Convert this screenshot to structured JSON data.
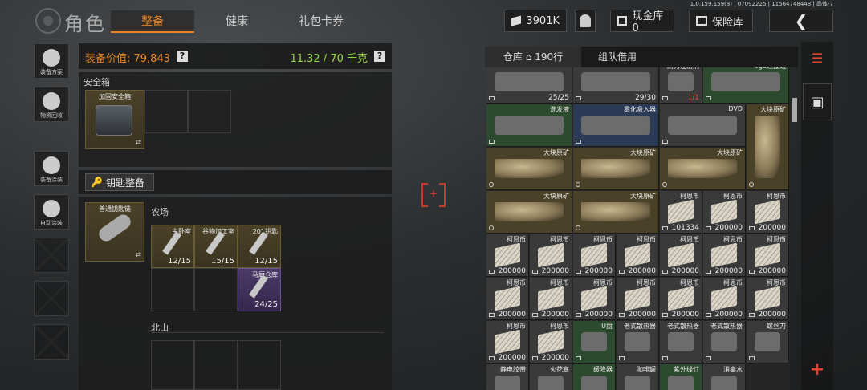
{
  "header": {
    "title": "角色",
    "tabs": [
      {
        "label": "整备",
        "active": true
      },
      {
        "label": "健康",
        "active": false
      },
      {
        "label": "礼包卡券",
        "active": false
      }
    ],
    "version": "1.0.159.159(8) | 07092225 | 11564748448 | 晶体-7",
    "money": "3901K",
    "cash_label": "现金库 0",
    "safe_label": "保险库",
    "back_icon": "chevron-left-icon"
  },
  "sidebar": [
    {
      "label": "装备方案",
      "icon": "gun-icon"
    },
    {
      "label": "物资回收",
      "icon": "recycle-icon"
    },
    {
      "label": "装备涂装",
      "icon": "paint-icon"
    },
    {
      "label": "自动涂装",
      "icon": "brush-icon"
    }
  ],
  "loadout": {
    "value_text": "装备价值: 79,843",
    "weight_text": "11.32 / 70 千克",
    "help": "?",
    "safebox_section": "安全箱",
    "safebox_item": "加固安全箱",
    "keys_button": "钥匙整备",
    "keychain_item": "普通钥匙链",
    "farm_section": "农场",
    "keys": [
      {
        "name": "主卧室",
        "count": "12/15",
        "color": "gold"
      },
      {
        "name": "谷物加工室",
        "count": "15/15",
        "color": "gold"
      },
      {
        "name": "201钥匙",
        "count": "12/15",
        "color": "gold"
      },
      {
        "name": "马厩仓库",
        "count": "24/25",
        "color": "purple"
      }
    ],
    "north_section": "北山"
  },
  "warehouse": {
    "tab_storage": "仓库",
    "rows": "190行",
    "tab_team": "组队借用",
    "cells": [
      {
        "n": "",
        "c": "25/25",
        "t": "gray",
        "w": 2,
        "h": 1
      },
      {
        "n": "",
        "c": "29/30",
        "t": "gray",
        "w": 2,
        "h": 1
      },
      {
        "n": "耐力注射剂",
        "c": "1/1",
        "t": "gray",
        "w": 1,
        "h": 1,
        "red": true
      },
      {
        "n": "vga连接线",
        "c": "",
        "t": "green",
        "w": 2,
        "h": 1
      },
      {
        "n": "洗发液",
        "c": "",
        "t": "green",
        "w": 2,
        "h": 1
      },
      {
        "n": "雾化吸入器",
        "c": "",
        "t": "blue",
        "w": 2,
        "h": 1
      },
      {
        "n": "DVD",
        "c": "",
        "t": "gray",
        "w": 2,
        "h": 1
      },
      {
        "n": "大块原矿",
        "c": "",
        "t": "gold",
        "w": 1,
        "h": 2
      },
      {
        "n": "大块原矿",
        "c": "",
        "t": "gold",
        "w": 2,
        "h": 1
      },
      {
        "n": "大块原矿",
        "c": "",
        "t": "gold",
        "w": 2,
        "h": 1
      },
      {
        "n": "大块原矿",
        "c": "",
        "t": "gold",
        "w": 2,
        "h": 1
      },
      {
        "n": "大块原矿",
        "c": "",
        "t": "gold",
        "w": 2,
        "h": 1
      },
      {
        "n": "大块原矿",
        "c": "",
        "t": "gold",
        "w": 2,
        "h": 1
      },
      {
        "n": "柯恩币",
        "c": "101334",
        "t": "gray",
        "w": 1,
        "h": 1
      },
      {
        "n": "柯恩币",
        "c": "200000",
        "t": "gray",
        "w": 1,
        "h": 1
      },
      {
        "n": "柯恩币",
        "c": "200000",
        "t": "gray",
        "w": 1,
        "h": 1
      },
      {
        "n": "柯恩币",
        "c": "200000",
        "t": "gray",
        "w": 1,
        "h": 1
      },
      {
        "n": "柯恩币",
        "c": "200000",
        "t": "gray",
        "w": 1,
        "h": 1
      },
      {
        "n": "柯恩币",
        "c": "200000",
        "t": "gray",
        "w": 1,
        "h": 1
      },
      {
        "n": "柯恩币",
        "c": "200000",
        "t": "gray",
        "w": 1,
        "h": 1
      },
      {
        "n": "柯恩币",
        "c": "200000",
        "t": "gray",
        "w": 1,
        "h": 1
      },
      {
        "n": "柯恩币",
        "c": "200000",
        "t": "gray",
        "w": 1,
        "h": 1
      },
      {
        "n": "柯恩币",
        "c": "200000",
        "t": "gray",
        "w": 1,
        "h": 1
      },
      {
        "n": "柯恩币",
        "c": "200000",
        "t": "gray",
        "w": 1,
        "h": 1
      },
      {
        "n": "柯恩币",
        "c": "200000",
        "t": "gray",
        "w": 1,
        "h": 1
      },
      {
        "n": "柯恩币",
        "c": "200000",
        "t": "gray",
        "w": 1,
        "h": 1
      },
      {
        "n": "柯恩币",
        "c": "200000",
        "t": "gray",
        "w": 1,
        "h": 1
      },
      {
        "n": "柯恩币",
        "c": "200000",
        "t": "gray",
        "w": 1,
        "h": 1
      },
      {
        "n": "柯恩币",
        "c": "200000",
        "t": "gray",
        "w": 1,
        "h": 1
      },
      {
        "n": "柯恩币",
        "c": "200000",
        "t": "gray",
        "w": 1,
        "h": 1
      },
      {
        "n": "柯恩币",
        "c": "200000",
        "t": "gray",
        "w": 1,
        "h": 1
      },
      {
        "n": "柯恩币",
        "c": "200000",
        "t": "gray",
        "w": 1,
        "h": 1
      },
      {
        "n": "U盘",
        "c": "",
        "t": "green",
        "w": 1,
        "h": 1
      },
      {
        "n": "老式散热器",
        "c": "",
        "t": "gray",
        "w": 1,
        "h": 1
      },
      {
        "n": "老式散热器",
        "c": "",
        "t": "gray",
        "w": 1,
        "h": 1
      },
      {
        "n": "老式散热器",
        "c": "",
        "t": "gray",
        "w": 1,
        "h": 1
      },
      {
        "n": "螺丝刀",
        "c": "",
        "t": "gray",
        "w": 1,
        "h": 1
      },
      {
        "n": "静电胶带",
        "c": "",
        "t": "gray",
        "w": 1,
        "h": 1
      },
      {
        "n": "火花塞",
        "c": "",
        "t": "gray",
        "w": 1,
        "h": 1
      },
      {
        "n": "缓降器",
        "c": "",
        "t": "green",
        "w": 1,
        "h": 1
      },
      {
        "n": "咖啡罐",
        "c": "",
        "t": "gray",
        "w": 1,
        "h": 1
      },
      {
        "n": "紫外线灯",
        "c": "",
        "t": "green",
        "w": 1,
        "h": 1
      },
      {
        "n": "消毒水",
        "c": "",
        "t": "gray",
        "w": 1,
        "h": 1
      }
    ]
  }
}
